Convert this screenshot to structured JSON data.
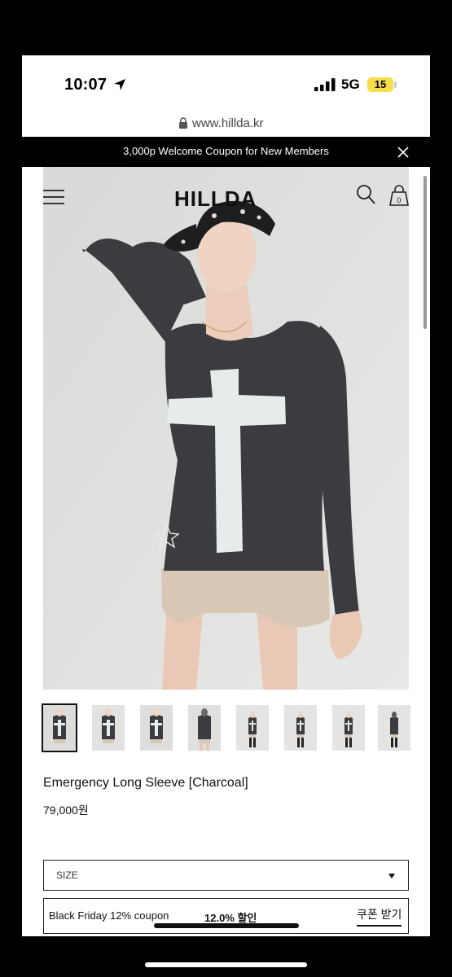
{
  "status_bar": {
    "time": "10:07",
    "network": "5G",
    "battery": "15"
  },
  "browser": {
    "url": "www.hillda.kr"
  },
  "banner": {
    "text": "3,000p Welcome Coupon for New Members"
  },
  "header": {
    "brand": "HILLDA",
    "cart_count": "0"
  },
  "product": {
    "name": "Emergency Long Sleeve [Charcoal]",
    "price": "79,000원",
    "thumbnail_count": 8
  },
  "options": {
    "size_label": "SIZE"
  },
  "coupon": {
    "text": "Black Friday 12% coupon",
    "discount": "12.0% 할인",
    "button": "쿠폰 받기"
  },
  "colors": {
    "banner_bg": "#000000",
    "battery": "#f6de4b",
    "shirt": "#3b3c3f"
  }
}
